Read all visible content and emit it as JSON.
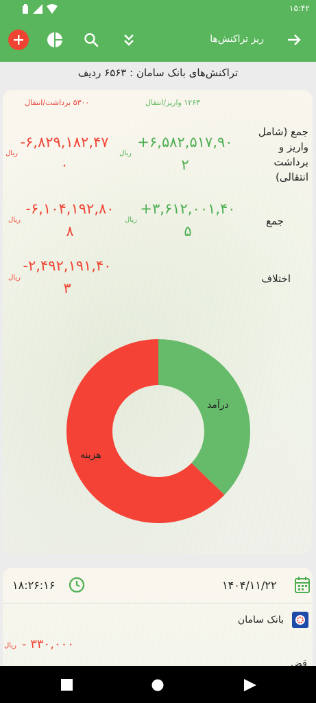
{
  "status_bar": {
    "time": "۱۵:۴۲"
  },
  "app_bar": {
    "title": "ریز تراکنش‌ها"
  },
  "summary": {
    "text": "تراکنش‌های بانک سامان : ۶۵۶۳ ردیف"
  },
  "stats": {
    "withdraw_count_label": "۵۳۰۰ برداشت/انتقال",
    "deposit_count_label": "۱۲۶۳ واریز/انتقال",
    "currency": "ریال",
    "rows": [
      {
        "label": "جمع (شامل واریز و برداشت انتقالی)",
        "positive": "+۶,۵۸۲,۵۱۷,۹۰۲",
        "negative": "-۶,۸۲۹,۱۸۲,۴۷۰"
      },
      {
        "label": "جمع",
        "positive": "+۳,۶۱۲,۰۰۱,۴۰۵",
        "negative": "-۶,۱۰۴,۱۹۲,۸۰۸"
      },
      {
        "label": "اختلاف",
        "negative": "-۲,۴۹۲,۱۹۱,۴۰۳"
      }
    ]
  },
  "chart_data": {
    "type": "pie",
    "categories": [
      "درآمد",
      "هزینه"
    ],
    "values": [
      3612001405,
      6104192808
    ],
    "colors": [
      "#66bb6a",
      "#f44336"
    ]
  },
  "transaction": {
    "time": "۱۸:۲۶:۱۶",
    "date": "۱۴۰۴/۱۱/۲۲",
    "bank": "بانک سامان",
    "amount": "- ۳۳۰,۰۰۰",
    "currency": "ریال",
    "cut_text": "قض"
  }
}
